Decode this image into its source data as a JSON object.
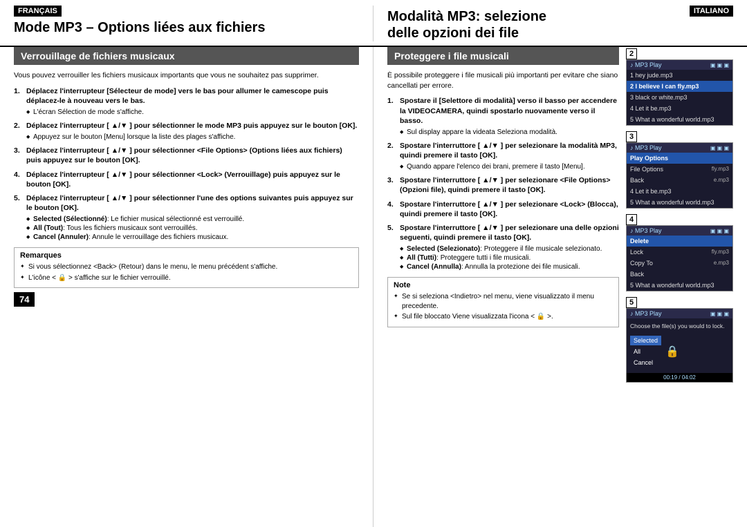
{
  "header": {
    "left_lang": "FRANÇAIS",
    "left_title_line1": "Mode MP3 – Options liées aux fichiers",
    "right_lang": "ITALIANO",
    "right_title_line1": "Modalità MP3: selezione",
    "right_title_line2": "delle opzioni dei file"
  },
  "left": {
    "section_title": "Verrouillage de fichiers musicaux",
    "intro": "Vous pouvez verrouiller les fichiers musicaux importants que vous ne souhaitez pas supprimer.",
    "steps": [
      {
        "num": "1.",
        "bold": "Déplacez l'interrupteur [Sélecteur de mode] vers  le bas pour allumer le camescope puis déplacez-le à nouveau vers le bas.",
        "normal": "",
        "bullet": "L'écran Sélection de mode s'affiche."
      },
      {
        "num": "2.",
        "bold": "Déplacez l'interrupteur [ ▲/▼ ] pour sélectionner le mode MP3 puis appuyez sur le bouton [OK].",
        "normal": "",
        "bullet": "Appuyez sur le bouton [Menu] lorsque la liste des plages s'affiche."
      },
      {
        "num": "3.",
        "bold": "Déplacez l'interrupteur [ ▲/▼ ] pour sélectionner <File Options> (Options liées aux fichiers) puis appuyez sur le bouton [OK].",
        "normal": "",
        "bullet": ""
      },
      {
        "num": "4.",
        "bold": "Déplacez l'interrupteur [ ▲/▼ ] pour sélectionner <Lock> (Verrouillage) puis appuyez sur le bouton [OK].",
        "normal": "",
        "bullet": ""
      },
      {
        "num": "5.",
        "bold": "Déplacez l'interrupteur [ ▲/▼ ] pour sélectionner l'une des options suivantes puis appuyez sur le bouton [OK].",
        "normal": "",
        "bullets": [
          "Selected (Sélectionné): Le fichier musical sélectionné est verrouillé.",
          "All (Tout): Tous les fichiers musicaux sont verrouillés.",
          "Cancel (Annuler): Annule le verrouillage des fichiers musicaux."
        ]
      }
    ],
    "remarques_title": "Remarques",
    "remarques": [
      "Si vous sélectionnez <Back> (Retour) dans le menu, le menu précédent s'affiche.",
      "L'icône < 🔒 > s'affiche sur le fichier verrouillé."
    ],
    "page_num": "74"
  },
  "right": {
    "section_title": "Proteggere i file musicali",
    "intro": "È possibile proteggere i file musicali più importanti per evitare che siano cancellati per errore.",
    "steps": [
      {
        "num": "1.",
        "text": "Spostare il [Selettore di modalità] verso il basso per accendere la VIDEOCAMERA, quindi spostarlo nuovamente verso il basso.",
        "bullet": "Sul display appare la videata Seleziona modalità."
      },
      {
        "num": "2.",
        "text": "Spostare l'interruttore [ ▲/▼ ] per selezionare la modalità MP3, quindi premere il tasto [OK].",
        "bullet": "Quando appare l'elenco dei brani, premere il tasto [Menu]."
      },
      {
        "num": "3.",
        "text": "Spostare l'interruttore [ ▲/▼ ] per selezionare <File Options> (Opzioni file), quindi premere il tasto [OK].",
        "bullet": ""
      },
      {
        "num": "4.",
        "text": "Spostare l'interruttore [ ▲/▼ ] per selezionare <Lock> (Blocca), quindi premere il tasto [OK].",
        "bullet": ""
      },
      {
        "num": "5.",
        "text": "Spostare l'interruttore [ ▲/▼ ] per selezionare una delle opzioni seguenti, quindi premere il tasto [OK].",
        "bullets": [
          "Selected (Selezionato): Proteggere il file musicale selezionato.",
          "All (Tutti): Proteggere tutti i file musicali.",
          "Cancel (Annulla): Annulla la protezione dei file musicali."
        ]
      }
    ],
    "note_title": "Note",
    "note_items": [
      "Se si seleziona <Indietro> nel menu, viene visualizzato il menu precedente.",
      "Sul file bloccato Viene visualizzata l'icona < 🔒 >."
    ]
  },
  "screens": [
    {
      "label": "2",
      "topbar": "♪ MP3 Play",
      "topbar_icons": "▣ ▣ ▣",
      "items": [
        {
          "text": "1  hey jude.mp3",
          "active": false
        },
        {
          "text": "2  I believe I can fly.mp3",
          "active": true
        },
        {
          "text": "3  black or white.mp3",
          "active": false
        },
        {
          "text": "4  Let it be.mp3",
          "active": false
        },
        {
          "text": "5  What a wonderful world.mp3",
          "active": false
        }
      ]
    },
    {
      "label": "3",
      "topbar": "♪ MP3 Play",
      "topbar_icons": "▣ ▣ ▣",
      "items": [
        {
          "text": "Play Options",
          "active": true
        },
        {
          "text": "File Options",
          "active": false,
          "suffix": "fly.mp3"
        },
        {
          "text": "Back",
          "active": false,
          "suffix": "e.mp3"
        },
        {
          "text": "4  Let it be.mp3",
          "active": false
        },
        {
          "text": "5  What a wonderful world.mp3",
          "active": false
        }
      ]
    },
    {
      "label": "4",
      "topbar": "♪ MP3 Play",
      "topbar_icons": "▣ ▣ ▣",
      "items": [
        {
          "text": "Delete",
          "active": true
        },
        {
          "text": "Lock",
          "active": false,
          "suffix": "fly.mp3"
        },
        {
          "text": "Copy To",
          "active": false,
          "suffix": "e.mp3"
        },
        {
          "text": "Back",
          "active": false
        },
        {
          "text": "5  What a wonderful world.mp3",
          "active": false
        }
      ]
    },
    {
      "label": "5",
      "topbar": "♪ MP3 Play",
      "topbar_icons": "▣ ▣ ▣",
      "prompt": "Choose the file(s) you would to lock.",
      "options": [
        {
          "text": "Selected",
          "highlighted": true
        },
        {
          "text": "All",
          "highlighted": false
        },
        {
          "text": "Cancel",
          "highlighted": false
        }
      ],
      "timecode": "00:19 / 04:02"
    }
  ]
}
